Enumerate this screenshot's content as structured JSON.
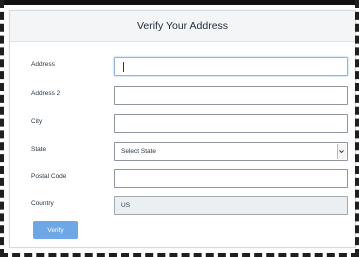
{
  "form": {
    "title": "Verify Your Address",
    "fields": [
      {
        "label": "Address",
        "value": ""
      },
      {
        "label": "Address 2",
        "value": ""
      },
      {
        "label": "City",
        "value": ""
      },
      {
        "label": "State",
        "value": "Select State"
      },
      {
        "label": "Postal Code",
        "value": ""
      },
      {
        "label": "Country",
        "value": "US"
      }
    ],
    "verify_label": "Verify"
  },
  "icons": {
    "state_dropdown": "chevron-down-icon"
  },
  "colors": {
    "button": "#6da7e6",
    "focus_border": "#8fb5e4"
  }
}
